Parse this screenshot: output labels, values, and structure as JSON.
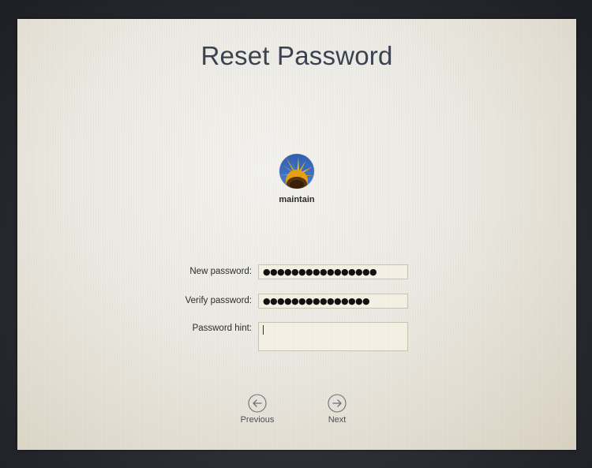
{
  "page": {
    "title": "Reset Password"
  },
  "user": {
    "name": "maintain",
    "avatar_icon": "sunflower-avatar-icon"
  },
  "form": {
    "new_password": {
      "label": "New password:",
      "masked_value": "●●●●●●●●●●●●●●●●"
    },
    "verify_password": {
      "label": "Verify password:",
      "masked_value": "●●●●●●●●●●●●●●●"
    },
    "password_hint": {
      "label": "Password hint:",
      "value": ""
    }
  },
  "navigation": {
    "previous": {
      "label": "Previous",
      "icon": "arrow-left-circle-icon"
    },
    "next": {
      "label": "Next",
      "icon": "arrow-right-circle-icon"
    }
  },
  "colors": {
    "screen_background": "#ebe9e2",
    "title_text": "#3c4250",
    "field_background": "#f4f1e4",
    "field_border": "#c9c5b5"
  }
}
